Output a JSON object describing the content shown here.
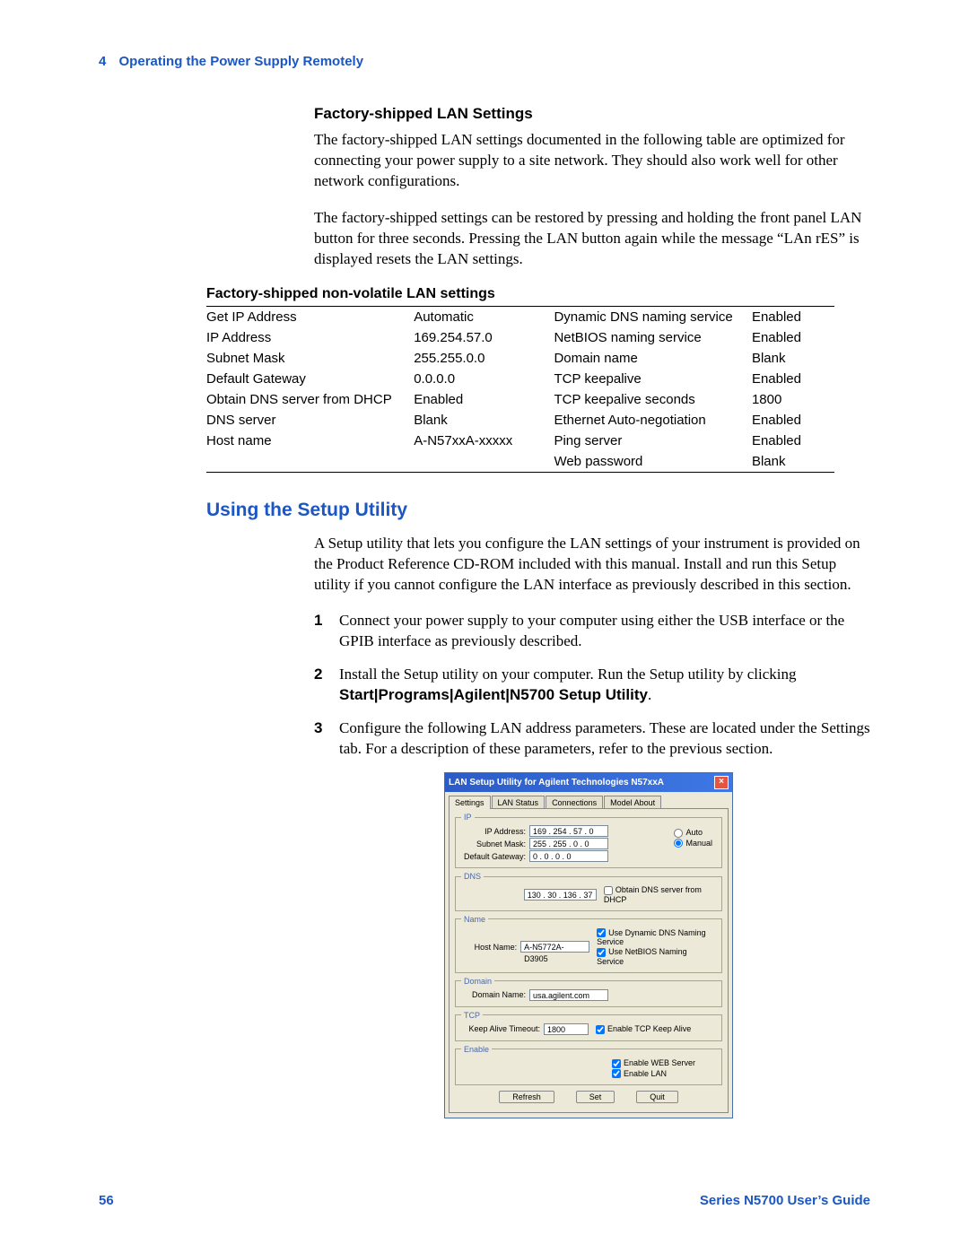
{
  "header": {
    "chapter_num": "4",
    "chapter_title": "Operating the Power Supply Remotely"
  },
  "factory": {
    "heading": "Factory-shipped LAN Settings",
    "p1": "The factory-shipped LAN settings documented in the following table are optimized for connecting your power supply to a site network. They should also work well for other network configurations.",
    "p2": "The factory-shipped settings can be restored by pressing and holding the front panel LAN button for three seconds. Pressing the LAN button again while the message “LAn rES” is displayed resets the LAN settings.",
    "table_title": "Factory-shipped non-volatile LAN settings",
    "rows": [
      {
        "a": "Get IP Address",
        "b": "Automatic",
        "c": "Dynamic DNS naming service",
        "d": "Enabled"
      },
      {
        "a": "IP Address",
        "b": "169.254.57.0",
        "c": "NetBIOS naming service",
        "d": "Enabled"
      },
      {
        "a": "Subnet Mask",
        "b": "255.255.0.0",
        "c": "Domain name",
        "d": "Blank"
      },
      {
        "a": "Default Gateway",
        "b": "0.0.0.0",
        "c": "TCP keepalive",
        "d": "Enabled"
      },
      {
        "a": "Obtain DNS server from DHCP",
        "b": "Enabled",
        "c": "TCP keepalive seconds",
        "d": "1800"
      },
      {
        "a": "DNS server",
        "b": "Blank",
        "c": "Ethernet Auto-negotiation",
        "d": "Enabled"
      },
      {
        "a": "Host name",
        "b": "A-N57xxA-xxxxx",
        "c": "Ping server",
        "d": "Enabled"
      },
      {
        "a": "",
        "b": "",
        "c": "Web password",
        "d": "Blank"
      }
    ]
  },
  "setup": {
    "heading": "Using the Setup Utility",
    "intro": "A Setup utility that lets you configure the LAN settings of your instrument is provided on the Product Reference CD-ROM included with this manual. Install and run this Setup utility if you cannot configure the LAN interface as previously described in this section.",
    "steps": [
      {
        "n": "1",
        "text": "Connect your power supply to your computer using either the USB interface or the GPIB interface as previously described."
      },
      {
        "n": "2",
        "text_a": "Install the Setup utility on your computer. Run the Setup utility by clicking ",
        "bold": "Start|Programs|Agilent|N5700 Setup Utility",
        "text_b": "."
      },
      {
        "n": "3",
        "text": "Configure the following LAN address parameters. These are located under the Settings tab. For a description of these parameters, refer to the previous section."
      }
    ]
  },
  "dialog": {
    "title": "LAN Setup Utility for Agilent Technologies N57xxA",
    "tabs": [
      "Settings",
      "LAN Status",
      "Connections",
      "Model About"
    ],
    "ip": {
      "legend": "IP",
      "addr_lbl": "IP Address:",
      "addr_val": "169 . 254 .  57 .   0",
      "mask_lbl": "Subnet Mask:",
      "mask_val": "255 . 255 .   0 .   0",
      "gw_lbl": "Default Gateway:",
      "gw_val": "  0 .   0 .   0 .   0",
      "auto": "Auto",
      "manual": "Manual"
    },
    "dns": {
      "legend": "DNS",
      "val": "130 .  30 . 136 .  37",
      "chk": "Obtain DNS server from DHCP"
    },
    "name": {
      "legend": "Name",
      "host_lbl": "Host Name:",
      "host_val": "A-N5772A-D3905",
      "c1": "Use Dynamic DNS Naming Service",
      "c2": "Use NetBIOS Naming Service"
    },
    "domain": {
      "legend": "Domain",
      "lbl": "Domain Name:",
      "val": "usa.agilent.com"
    },
    "tcp": {
      "legend": "TCP",
      "lbl": "Keep Alive Timeout:",
      "val": "1800",
      "chk": "Enable TCP Keep Alive"
    },
    "enable": {
      "legend": "Enable",
      "c1": "Enable WEB Server",
      "c2": "Enable LAN"
    },
    "buttons": {
      "refresh": "Refresh",
      "set": "Set",
      "quit": "Quit"
    }
  },
  "footer": {
    "page": "56",
    "guide": "Series N5700 User’s Guide"
  }
}
